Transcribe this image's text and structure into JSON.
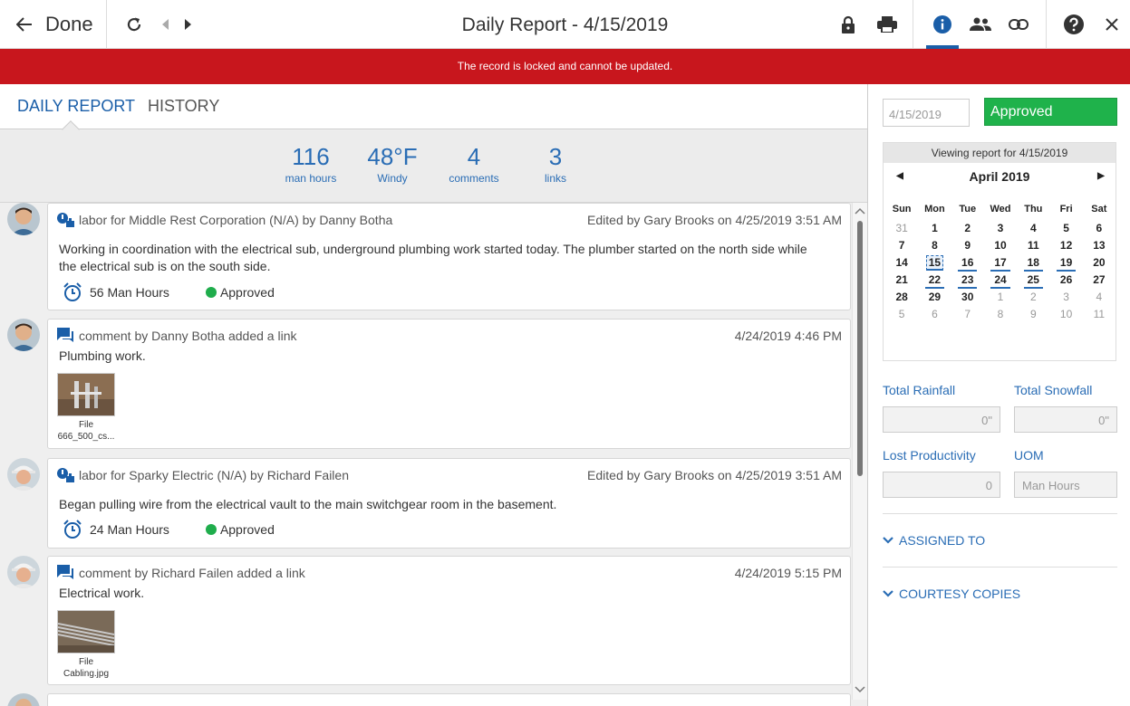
{
  "header": {
    "done_label": "Done",
    "title": "Daily Report - 4/15/2019"
  },
  "banner": {
    "message": "The record is locked and cannot be updated."
  },
  "tabs": [
    {
      "label": "DAILY REPORT",
      "active": true
    },
    {
      "label": "HISTORY",
      "active": false
    }
  ],
  "stats": [
    {
      "value": "116",
      "label": "man hours"
    },
    {
      "value": "48°F",
      "label": "Windy"
    },
    {
      "value": "4",
      "label": "comments"
    },
    {
      "value": "3",
      "label": "links"
    }
  ],
  "feed": [
    {
      "type": "labor",
      "header": "labor for Middle Rest Corporation (N/A) by Danny Botha",
      "when": "Edited by Gary Brooks on 4/25/2019 3:51 AM",
      "body": "Working in coordination with the electrical sub, underground plumbing work started today. The plumber started on the north side while the electrical sub is on the south side.",
      "hours": "56 Man Hours",
      "status": "Approved"
    },
    {
      "type": "comment",
      "header": "comment by Danny Botha added a link",
      "when": "4/24/2019 4:46 PM",
      "body": "Plumbing work.",
      "file_label": "File",
      "file_name": "666_500_cs..."
    },
    {
      "type": "labor",
      "header": "labor for Sparky Electric (N/A) by Richard Failen",
      "when": "Edited by Gary Brooks on 4/25/2019 3:51 AM",
      "body": "Began pulling wire from the electrical vault to the main switchgear room in the basement.",
      "hours": "24 Man Hours",
      "status": "Approved"
    },
    {
      "type": "comment",
      "header": "comment by Richard Failen added a link",
      "when": "4/24/2019 5:15 PM",
      "body": "Electrical work.",
      "file_label": "File",
      "file_name": "Cabling.jpg"
    }
  ],
  "sidebar": {
    "date_value": "4/15/2019",
    "status": "Approved",
    "calendar": {
      "viewing": "Viewing report for 4/15/2019",
      "month": "April 2019",
      "weekdays": [
        "Sun",
        "Mon",
        "Tue",
        "Wed",
        "Thu",
        "Fri",
        "Sat"
      ],
      "weeks": [
        [
          "31",
          "1",
          "2",
          "3",
          "4",
          "5",
          "6"
        ],
        [
          "7",
          "8",
          "9",
          "10",
          "11",
          "12",
          "13"
        ],
        [
          "14",
          "15",
          "16",
          "17",
          "18",
          "19",
          "20"
        ],
        [
          "21",
          "22",
          "23",
          "24",
          "25",
          "26",
          "27"
        ],
        [
          "28",
          "29",
          "30",
          "1",
          "2",
          "3",
          "4"
        ],
        [
          "5",
          "6",
          "7",
          "8",
          "9",
          "10",
          "11"
        ]
      ]
    },
    "total_rainfall_label": "Total Rainfall",
    "total_rainfall_value": "0\"",
    "total_snowfall_label": "Total Snowfall",
    "total_snowfall_value": "0\"",
    "lost_productivity_label": "Lost Productivity",
    "lost_productivity_value": "0",
    "uom_label": "UOM",
    "uom_value": "Man Hours",
    "assigned_to_label": "ASSIGNED TO",
    "courtesy_copies_label": "COURTESY COPIES"
  }
}
